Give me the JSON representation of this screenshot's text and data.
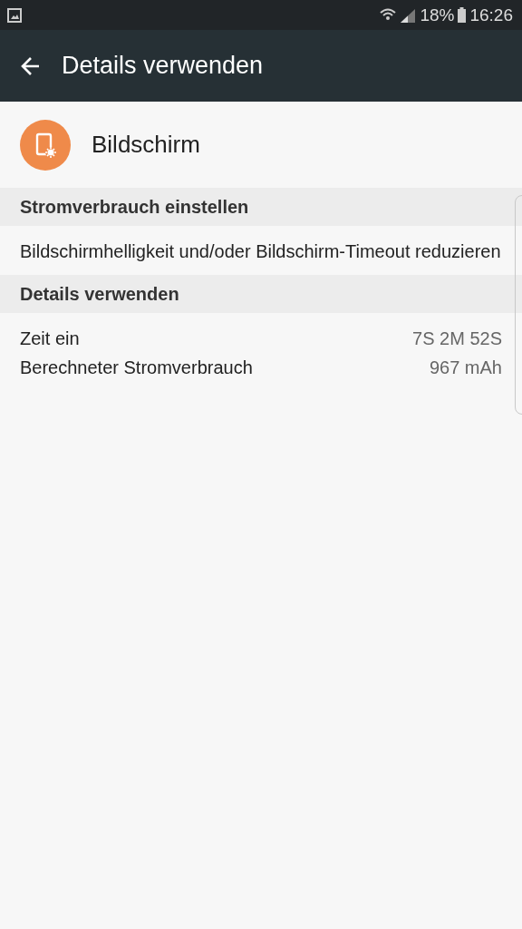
{
  "status_bar": {
    "battery": "18%",
    "time": "16:26"
  },
  "app_bar": {
    "title": "Details verwenden"
  },
  "app": {
    "name": "Bildschirm"
  },
  "sections": [
    {
      "kind": "text",
      "header": "Stromverbrauch einstellen",
      "text": "Bildschirmhelligkeit und/oder Bildschirm-Timeout reduzieren"
    },
    {
      "kind": "rows",
      "header": "Details verwenden",
      "rows": [
        {
          "label": "Zeit ein",
          "value": "7S 2M 52S"
        },
        {
          "label": "Berechneter Stromverbrauch",
          "value": "967 mAh"
        }
      ]
    }
  ]
}
